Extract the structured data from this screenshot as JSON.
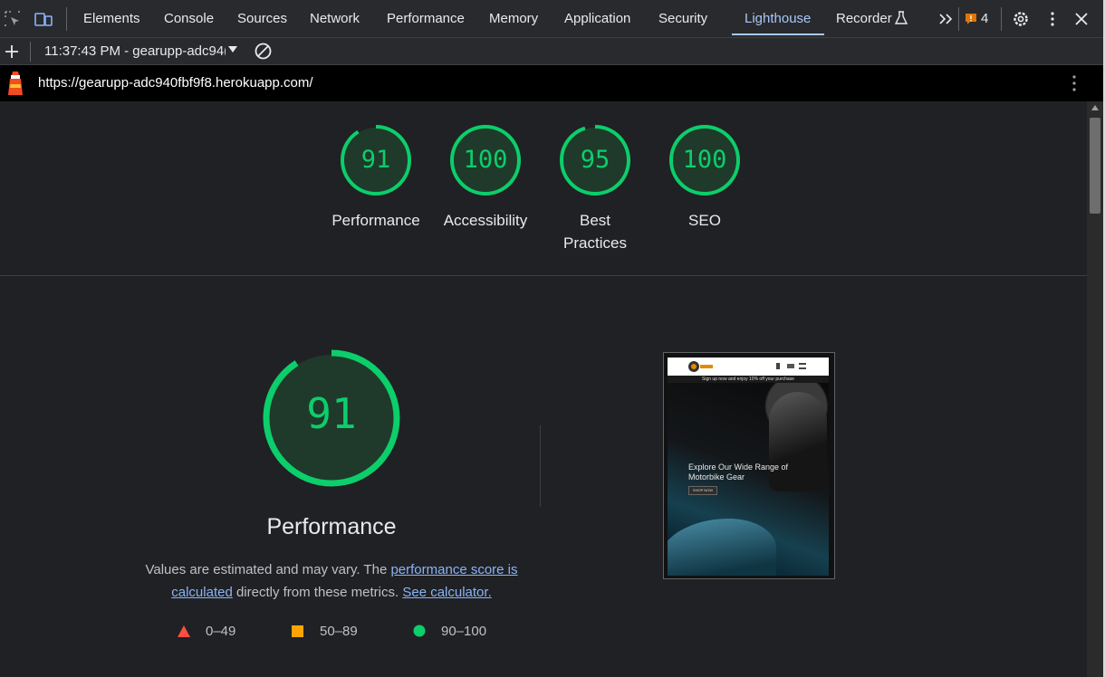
{
  "devtools": {
    "tabs": [
      {
        "label": "Elements"
      },
      {
        "label": "Console"
      },
      {
        "label": "Sources"
      },
      {
        "label": "Network"
      },
      {
        "label": "Performance"
      },
      {
        "label": "Memory"
      },
      {
        "label": "Application"
      },
      {
        "label": "Security"
      },
      {
        "label": "Lighthouse",
        "active": true
      },
      {
        "label": "Recorder"
      }
    ],
    "issues_count": "4",
    "report_selector": "11:37:43 PM - gearupp-adc94(",
    "icons": [
      "inspect-icon",
      "device-toolbar-icon",
      "flask-icon",
      "more-tabs-icon",
      "issues-icon",
      "settings-icon",
      "kebab-menu-icon",
      "close-icon",
      "add-icon",
      "clear-icon",
      "lighthouse-icon"
    ]
  },
  "report": {
    "url": "https://gearupp-adc940fbf9f8.herokuapp.com/",
    "scores": [
      {
        "value": "91",
        "label": "Performance",
        "fraction": 0.91
      },
      {
        "value": "100",
        "label": "Accessibility",
        "fraction": 1.0
      },
      {
        "value": "95",
        "label": "Best Practices",
        "fraction": 0.95
      },
      {
        "value": "100",
        "label": "SEO",
        "fraction": 1.0
      }
    ],
    "performance": {
      "score": "91",
      "fraction": 0.91,
      "title": "Performance",
      "desc_prefix": "Values are estimated and may vary. The ",
      "link1": "performance score is calculated",
      "desc_mid": " directly from these metrics. ",
      "link2": "See calculator."
    },
    "legend": [
      {
        "range": "0–49",
        "color": "#ff4e42",
        "shape": "triangle"
      },
      {
        "range": "50–89",
        "color": "#ffa400",
        "shape": "square"
      },
      {
        "range": "90–100",
        "color": "#0cce6b",
        "shape": "circle"
      }
    ],
    "screenshot": {
      "banner": "Sign up now and enjoy 10% off your purchase",
      "headline_line1": "Explore Our Wide Range of",
      "headline_line2": "Motorbike Gear",
      "button": "SHOP NOW"
    }
  },
  "colors": {
    "pass": "#0cce6b",
    "accent": "#a8c7fa",
    "link": "#8ab4f8",
    "background": "#202124"
  }
}
